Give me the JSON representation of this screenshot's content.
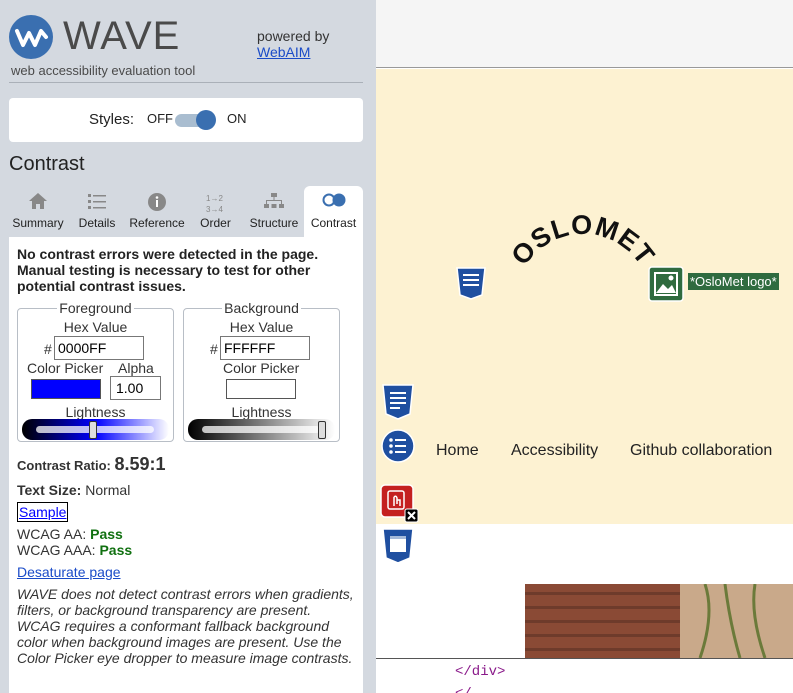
{
  "sidebar": {
    "logo_word": "WAVE",
    "tagline": "web accessibility evaluation tool",
    "powered_by": "powered by",
    "webaim_link": "WebAIM",
    "styles_label": "Styles:",
    "styles_off": "OFF",
    "styles_on": "ON",
    "styles_state": "on",
    "section_title": "Contrast",
    "tabs": [
      {
        "label": "Summary",
        "icon": "home-icon"
      },
      {
        "label": "Details",
        "icon": "list-icon"
      },
      {
        "label": "Reference",
        "icon": "info-icon"
      },
      {
        "label": "Order",
        "icon": "order-icon"
      },
      {
        "label": "Structure",
        "icon": "structure-icon"
      },
      {
        "label": "Contrast",
        "icon": "contrast-icon",
        "active": true
      }
    ],
    "message": "No contrast errors were detected in the page. Manual testing is necessary to test for other potential contrast issues.",
    "foreground": {
      "legend": "Foreground",
      "hex_label": "Hex Value",
      "hash": "#",
      "hex_value": "0000FF",
      "color_picker_label": "Color Picker",
      "swatch_color": "#0000ff",
      "alpha_label": "Alpha",
      "alpha_value": "1.00",
      "lightness_label": "Lightness",
      "lightness": 0.5
    },
    "background": {
      "legend": "Background",
      "hex_label": "Hex Value",
      "hash": "#",
      "hex_value": "FFFFFF",
      "color_picker_label": "Color Picker",
      "swatch_color": "#ffffff",
      "lightness_label": "Lightness",
      "lightness": 1.0
    },
    "contrast_ratio_label": "Contrast Ratio:",
    "contrast_ratio_value": "8.59:1",
    "text_size_label": "Text Size:",
    "text_size_value": "Normal",
    "sample": "Sample",
    "wcag_aa_label": "WCAG AA:",
    "wcag_aa_value": "Pass",
    "wcag_aaa_label": "WCAG AAA:",
    "wcag_aaa_value": "Pass",
    "desaturate_link": "Desaturate page",
    "note": "WAVE does not detect contrast errors when gradients, filters, or background transparency are present. WCAG requires a conformant fallback background color when background images are present. Use the Color Picker eye dropper to measure image contrasts."
  },
  "page": {
    "logo_text": "OSLOMET",
    "alt_text": "*OsloMet logo*",
    "nav": [
      "Home",
      "Accessibility",
      "Github collaboration"
    ],
    "code_line_1": "</div>",
    "code_line_2": "</",
    "colors": {
      "banner": "#fdf2d2",
      "html5_flag": "#1f4fa0",
      "alt_flag": "#2f6b3f",
      "error_flag": "#c42020"
    }
  }
}
